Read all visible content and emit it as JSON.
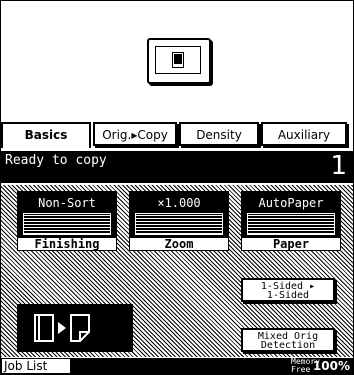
{
  "tabs": [
    {
      "label": "Basics"
    },
    {
      "label": "Orig.▸Copy"
    },
    {
      "label": "Density"
    },
    {
      "label": "Auxiliary"
    }
  ],
  "status": {
    "message": "Ready to copy",
    "count": "1"
  },
  "settings": {
    "finishing": {
      "value": "Non-Sort",
      "label": "Finishing"
    },
    "zoom": {
      "value": "×1.000",
      "label": "Zoom"
    },
    "paper": {
      "value": "AutoPaper",
      "label": "Paper"
    }
  },
  "buttons": {
    "sided_line1": "1-Sided ▸",
    "sided_line2": "1-Sided",
    "mixed_line1": "Mixed Orig",
    "mixed_line2": "Detection"
  },
  "bottom": {
    "job_list": "Job List",
    "memory_line1": "Memory",
    "memory_line2": "Free",
    "memory_value": "100%"
  },
  "icons": {
    "start": "document-icon",
    "preview": "original-to-copy-icon"
  }
}
